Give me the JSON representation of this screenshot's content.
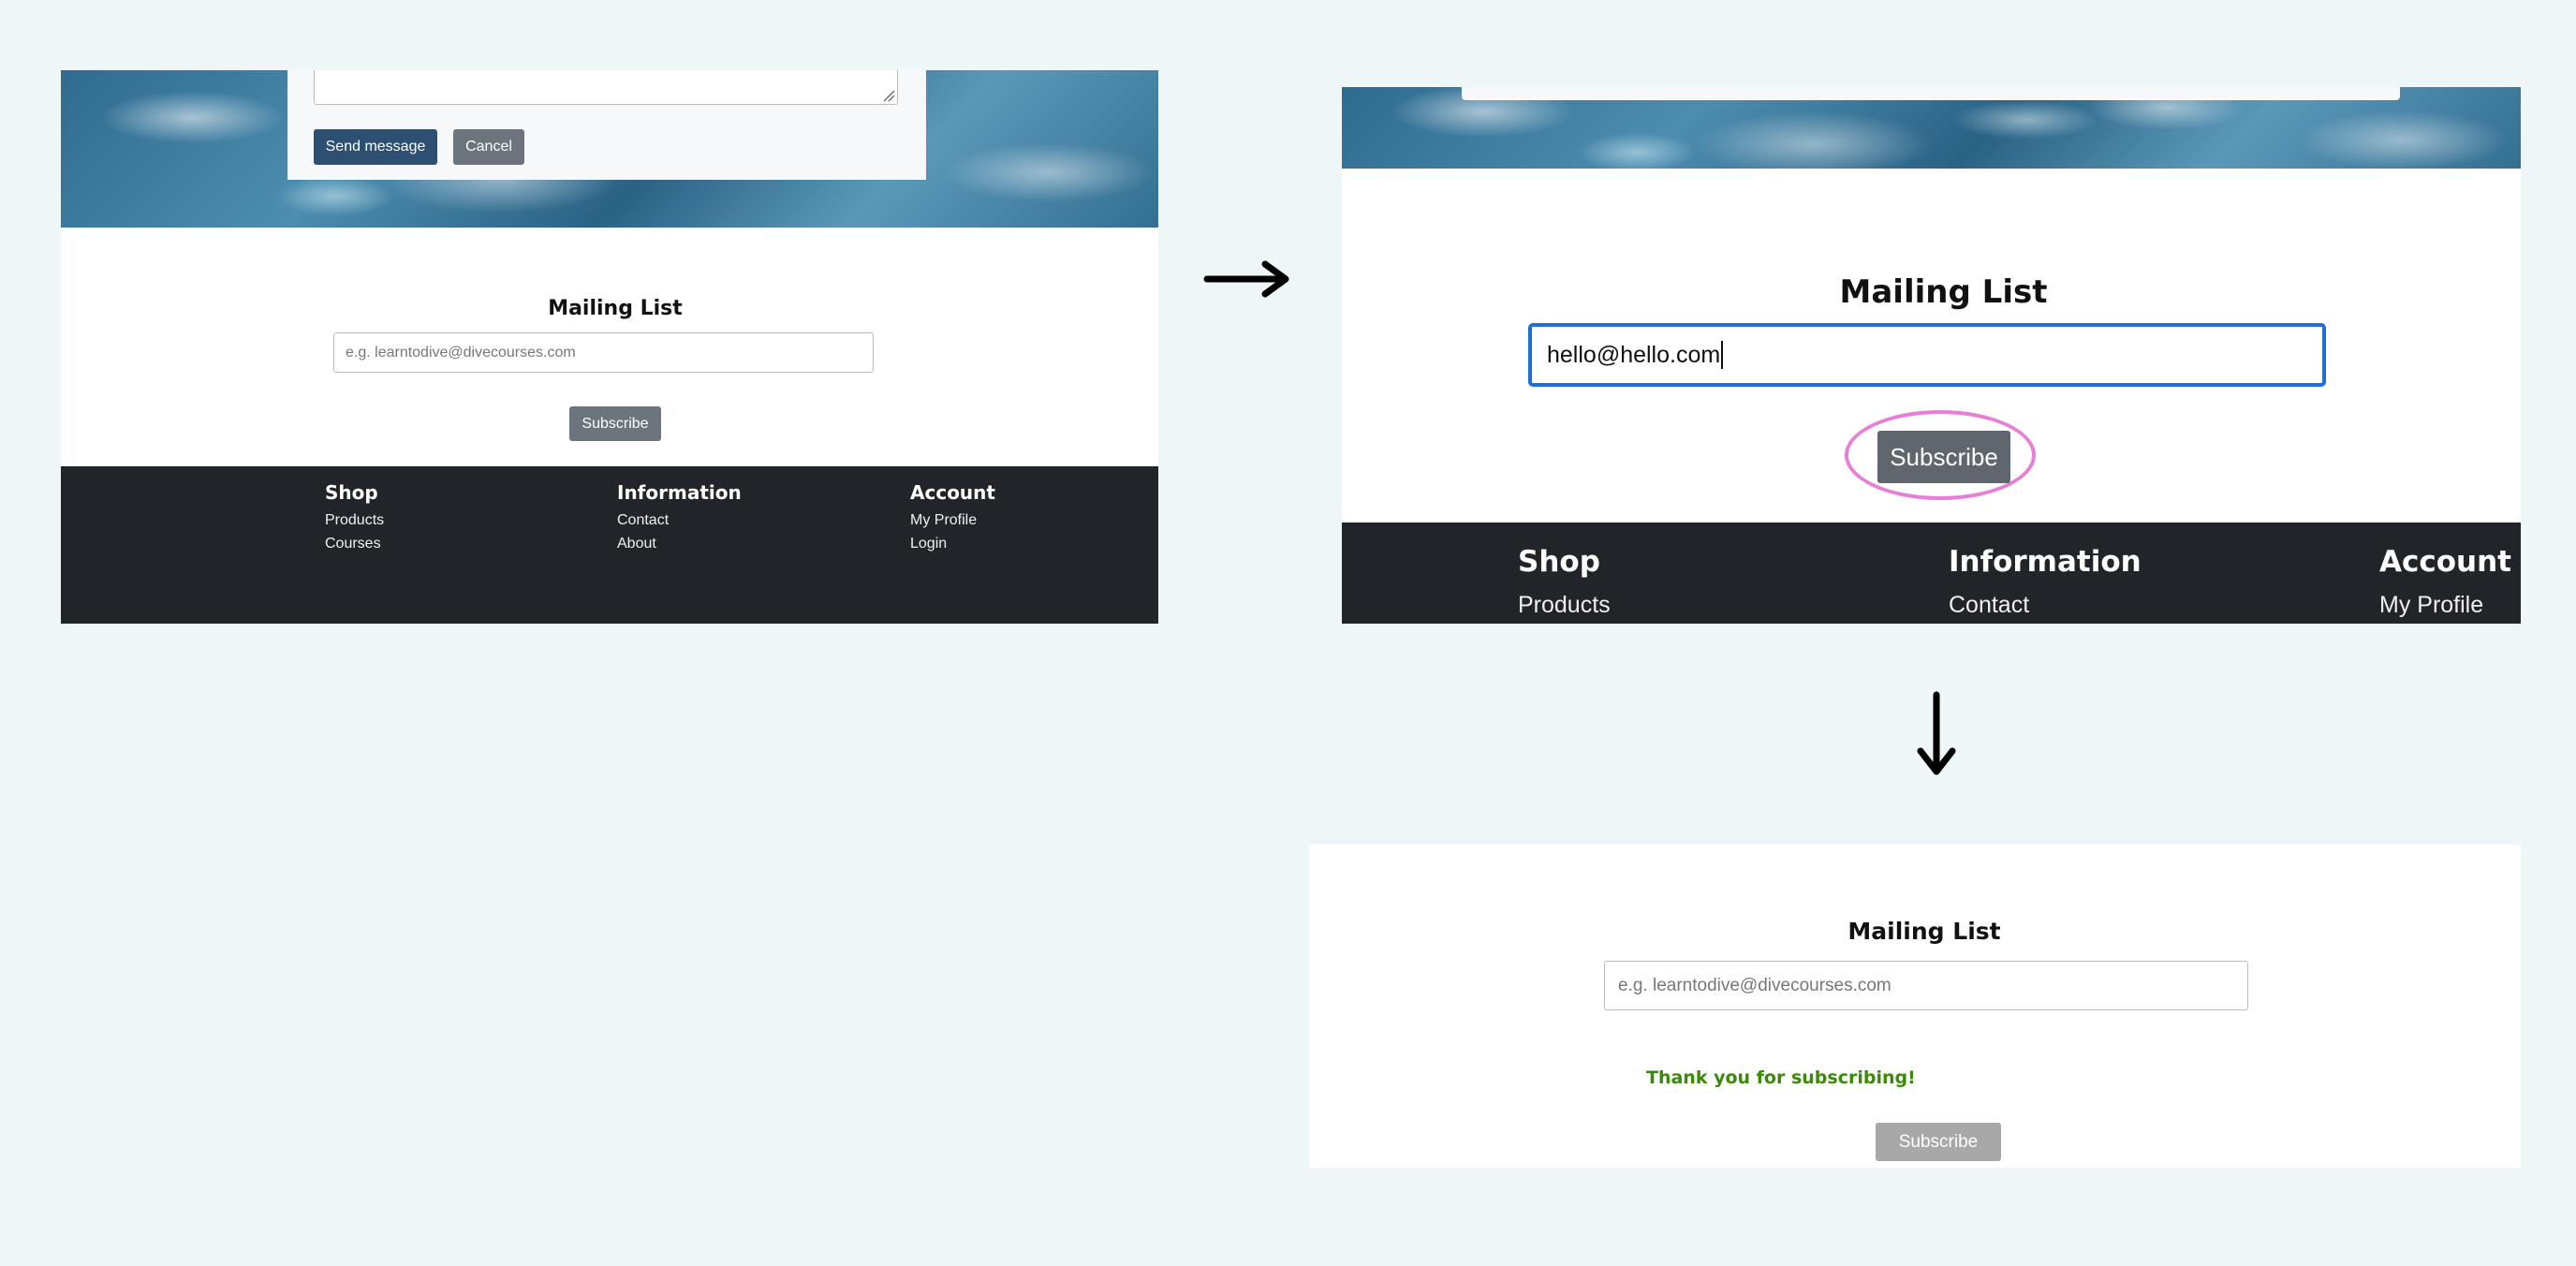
{
  "step1": {
    "contact_form": {
      "send_label": "Send message",
      "cancel_label": "Cancel"
    },
    "mailing": {
      "title": "Mailing List",
      "placeholder": "e.g. learntodive@divecourses.com",
      "subscribe_label": "Subscribe"
    },
    "footer": {
      "columns": [
        {
          "title": "Shop",
          "links": [
            "Products",
            "Courses"
          ]
        },
        {
          "title": "Information",
          "links": [
            "Contact",
            "About"
          ]
        },
        {
          "title": "Account",
          "links": [
            "My Profile",
            "Login"
          ]
        }
      ]
    }
  },
  "step2": {
    "mailing": {
      "title": "Mailing List",
      "input_value": "hello@hello.com",
      "subscribe_label": "Subscribe"
    },
    "footer": {
      "columns": [
        {
          "title": "Shop",
          "links": [
            "Products"
          ]
        },
        {
          "title": "Information",
          "links": [
            "Contact"
          ]
        },
        {
          "title": "Account",
          "links": [
            "My Profile"
          ]
        }
      ]
    }
  },
  "step3": {
    "mailing": {
      "title": "Mailing List",
      "placeholder": "e.g. learntodive@divecourses.com",
      "success_message": "Thank you for subscribing!",
      "subscribe_label": "Subscribe"
    }
  },
  "colors": {
    "primary_button": "#2c4f72",
    "secondary_button": "#6c757d",
    "disabled_button": "#a8a8a8",
    "focus_border": "#1f6fd6",
    "highlight_ring": "#e77fd8",
    "success_text": "#3a8a0a",
    "footer_bg": "#212529"
  },
  "icons": [
    "arrow-right-icon",
    "arrow-down-icon",
    "resize-handle-icon"
  ]
}
